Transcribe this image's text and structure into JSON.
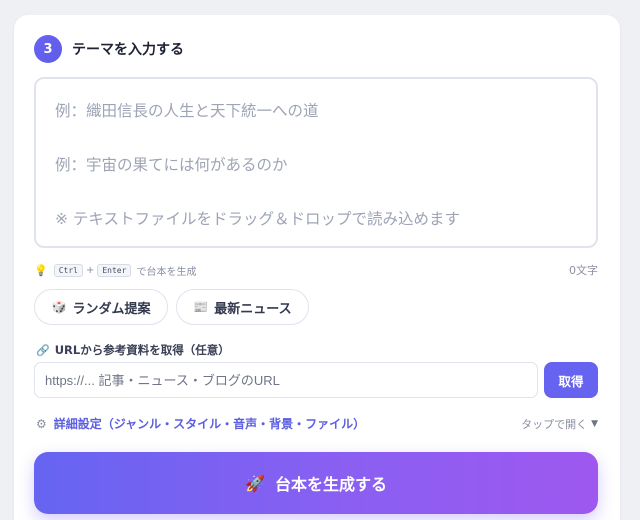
{
  "step": {
    "number": "3",
    "title": "テーマを入力する"
  },
  "theme_input": {
    "value": "",
    "placeholder_lines": [
      "例：織田信長の人生と天下統一への道",
      "例：宇宙の果てには何があるのか",
      "※ テキストファイルをドラッグ＆ドロップで読み込めます"
    ]
  },
  "hint": {
    "icon": "lightbulb-icon",
    "key1": "Ctrl",
    "plus": "+",
    "key2": "Enter",
    "text": "で台本を生成",
    "char_count": "0文字"
  },
  "suggestions": {
    "random": {
      "icon": "dice-icon",
      "label": "ランダム提案"
    },
    "news": {
      "icon": "newspaper-icon",
      "label": "最新ニュース"
    }
  },
  "url_fetch": {
    "icon": "link-icon",
    "label": "URLから参考資料を取得（任意）",
    "placeholder": "https://... 記事・ニュース・ブログのURL",
    "button_label": "取得"
  },
  "advanced": {
    "icon": "gear-icon",
    "label": "詳細設定（ジャンル・スタイル・音声・背景・ファイル）",
    "toggle_label": "タップで開く"
  },
  "generate": {
    "icon": "rocket-icon",
    "label": "台本を生成する"
  },
  "colors": {
    "accent": "#6563f0",
    "gradient_end": "#9e58f0"
  }
}
